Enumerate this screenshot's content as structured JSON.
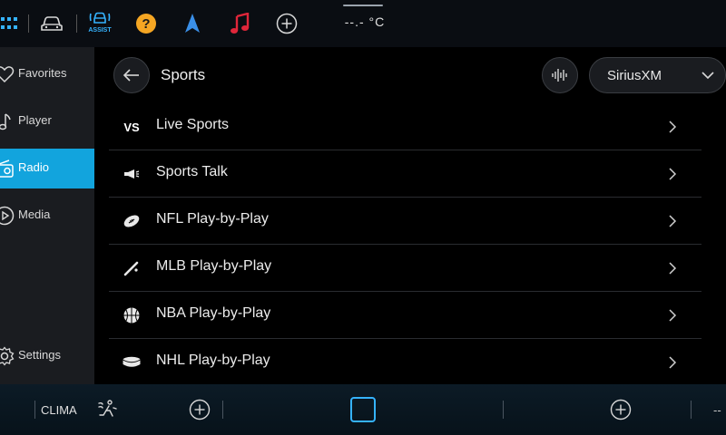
{
  "topbar": {
    "assist_label": "ASSIST",
    "temperature": "--.- °C"
  },
  "sidebar": {
    "items": [
      {
        "label": "Favorites",
        "icon": "heart-icon"
      },
      {
        "label": "Player",
        "icon": "music-note-icon"
      },
      {
        "label": "Radio",
        "icon": "radio-icon",
        "active": true
      },
      {
        "label": "Media",
        "icon": "play-circle-icon"
      },
      {
        "label": "Settings",
        "icon": "gear-icon"
      }
    ]
  },
  "header": {
    "title": "Sports",
    "source": "SiriusXM"
  },
  "list": {
    "items": [
      {
        "label": "Live Sports",
        "icon": "vs-icon",
        "icon_text": "VS"
      },
      {
        "label": "Sports Talk",
        "icon": "megaphone-icon"
      },
      {
        "label": "NFL Play-by-Play",
        "icon": "football-icon"
      },
      {
        "label": "MLB Play-by-Play",
        "icon": "baseball-bat-icon"
      },
      {
        "label": "NBA Play-by-Play",
        "icon": "basketball-icon"
      },
      {
        "label": "NHL Play-by-Play",
        "icon": "hockey-puck-icon"
      }
    ]
  },
  "bottombar": {
    "clima_label": "CLIMA",
    "right_text": "--"
  },
  "colors": {
    "accent": "#12a4dd",
    "assist_blue": "#35b3ff",
    "help_yellow": "#f5a623",
    "music_red": "#e0263a",
    "nav_blue": "#3a8fe8"
  }
}
